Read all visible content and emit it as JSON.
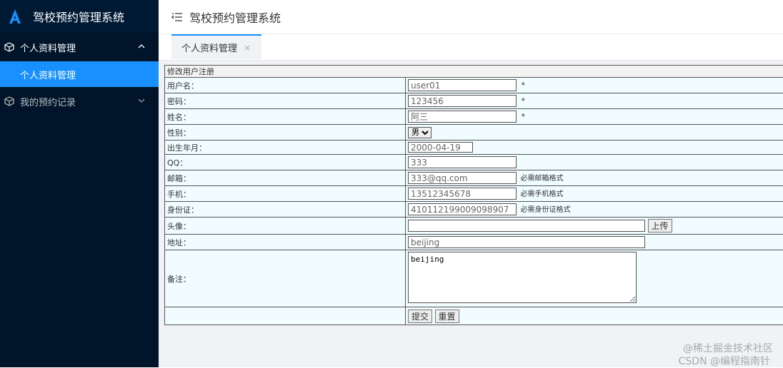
{
  "app": {
    "title": "驾校预约管理系统"
  },
  "sidebar": {
    "groups": [
      {
        "label": "个人资料管理",
        "expanded": true,
        "items": [
          {
            "label": "个人资料管理",
            "active": true
          }
        ]
      },
      {
        "label": "我的预约记录",
        "expanded": false
      }
    ]
  },
  "topbar": {
    "title": "驾校预约管理系统"
  },
  "tabs": [
    {
      "label": "个人资料管理",
      "close": "×"
    }
  ],
  "form": {
    "heading": "修改用户注册",
    "fields": {
      "username": {
        "label": "用户名：",
        "value": "user01",
        "mark": "*"
      },
      "password": {
        "label": "密码：",
        "value": "123456",
        "mark": "*"
      },
      "name": {
        "label": "姓名：",
        "value": "阿三",
        "mark": "*"
      },
      "gender": {
        "label": "性别：",
        "value": "男"
      },
      "birth": {
        "label": "出生年月：",
        "value": "2000-04-19"
      },
      "qq": {
        "label": "QQ：",
        "value": "333"
      },
      "email": {
        "label": "邮箱：",
        "value": "333@qq.com",
        "hint": "必需邮箱格式"
      },
      "phone": {
        "label": "手机：",
        "value": "13512345678",
        "hint": "必需手机格式"
      },
      "idcard": {
        "label": "身份证：",
        "value": "410112199009098907",
        "hint": "必需身份证格式"
      },
      "avatar": {
        "label": "头像：",
        "value": "",
        "upload": "上传"
      },
      "address": {
        "label": "地址：",
        "value": "beijing"
      },
      "remark": {
        "label": "备注：",
        "value": "beijing"
      }
    },
    "submit": "提交",
    "reset": "重置"
  },
  "watermark": {
    "line1": "@稀土掘金技术社区",
    "line2": "CSDN @编程指南针"
  }
}
